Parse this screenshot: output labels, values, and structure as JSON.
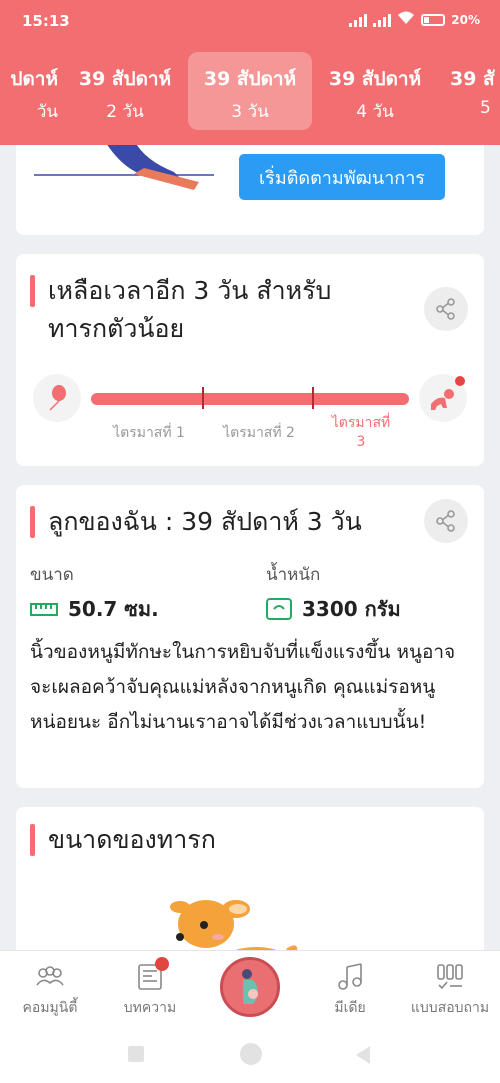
{
  "status": {
    "time": "15:13",
    "battery": "20%"
  },
  "weeks": [
    {
      "w": "ปดาห์",
      "d": "วัน"
    },
    {
      "w": "39 สัปดาห์",
      "d": "2 วัน"
    },
    {
      "w": "39 สัปดาห์",
      "d": "3 วัน"
    },
    {
      "w": "39 สัปดาห์",
      "d": "4 วัน"
    },
    {
      "w": "39 สั",
      "d": "5"
    }
  ],
  "development": {
    "button_label": "เริ่มติดตามพัฒนาการ"
  },
  "countdown": {
    "title_line1": "เหลือเวลาอีก 3 วัน สำหรับ",
    "title_line2": "ทารกตัวน้อย",
    "trimester1": "ไตรมาสที่ 1",
    "trimester2": "ไตรมาสที่ 2",
    "trimester3_a": "ไตรมาสที่",
    "trimester3_b": "3",
    "current_trimester": 3
  },
  "baby": {
    "title": "ลูกของฉัน : 39 สัปดาห์ 3  วัน",
    "size_label": "ขนาด",
    "size_value": "50.7 ซม.",
    "weight_label": "น้ำหนัก",
    "weight_value": "3300 กรัม",
    "description": "นิ้วของหนูมีทักษะในการหยิบจับที่แข็งแรงขึ้น หนูอาจจะเผลอคว้าจับคุณแม่หลังจากหนูเกิด คุณแม่รอหนูหน่อยนะ อีกไม่นานเราอาจได้มีช่วงเวลาแบบนั้น!"
  },
  "baby_size": {
    "title": "ขนาดของทารก"
  },
  "nav": {
    "community": "คอมมูนิตี้",
    "articles": "บทความ",
    "media": "มีเดีย",
    "quiz": "แบบสอบถาม"
  },
  "colors": {
    "primary": "#f26e70",
    "accent_blue": "#2b9bf4",
    "green": "#27a85f"
  }
}
